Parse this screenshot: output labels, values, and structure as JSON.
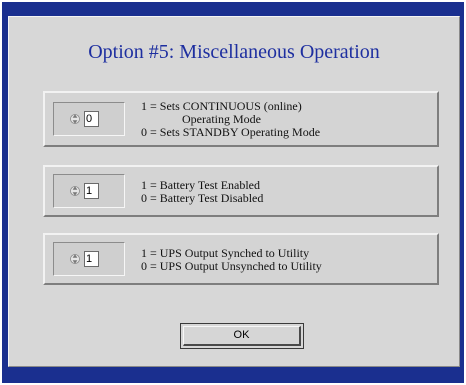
{
  "dialog": {
    "title": "Option #5: Miscellaneous Operation",
    "ok_label": "OK"
  },
  "options": [
    {
      "value": "0",
      "line1": "1 = Sets CONTINUOUS (online)",
      "line1_cont": "Operating Mode",
      "line2": "0 = Sets STANDBY Operating Mode"
    },
    {
      "value": "1",
      "line1": "1 = Battery Test Enabled",
      "line2": "0 = Battery Test Disabled"
    },
    {
      "value": "1",
      "line1": "1 = UPS Output Synched to Utility",
      "line2": "0 = UPS Output Unsynched to Utility"
    }
  ],
  "colors": {
    "frame": "#1a2f8f",
    "title": "#1e2fa0",
    "panel": "#d7d7d7"
  }
}
